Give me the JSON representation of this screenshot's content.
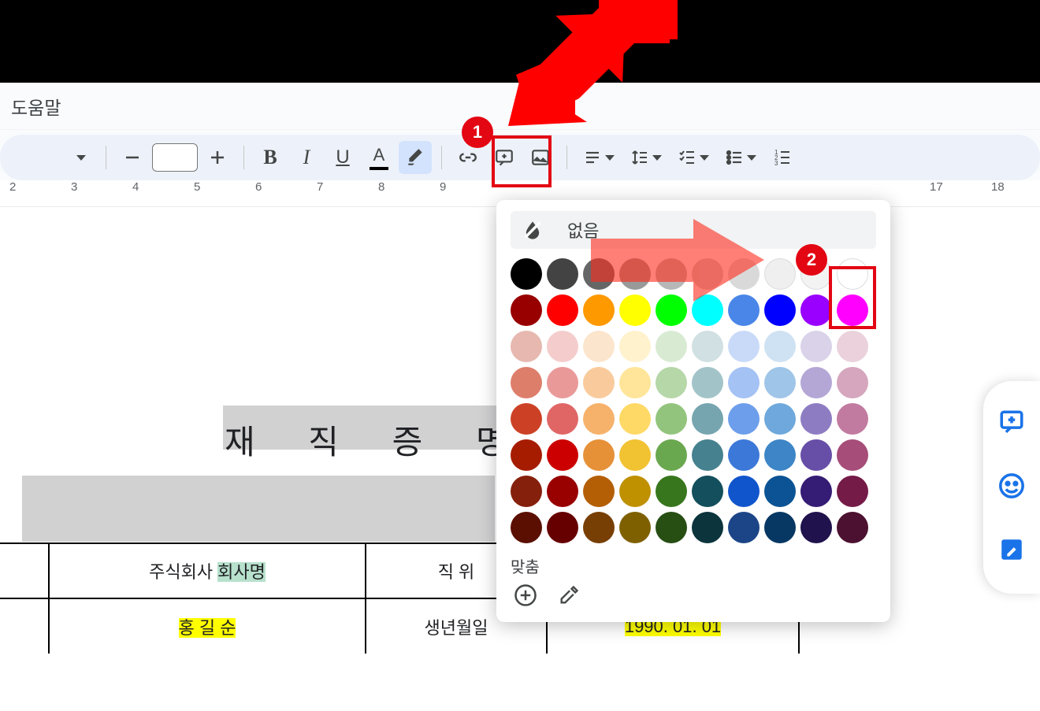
{
  "menubar": {
    "help": "도움말"
  },
  "toolbar": {
    "icons": [
      "font-dropdown",
      "decrease-font",
      "fontsize-box",
      "increase-font",
      "bold",
      "italic",
      "underline",
      "text-color",
      "highlight-color",
      "insert-link",
      "add-comment",
      "insert-image",
      "align",
      "line-spacing",
      "checklist",
      "bulleted-list",
      "numbered-list"
    ]
  },
  "ruler": {
    "numbers": [
      2,
      3,
      4,
      5,
      6,
      7,
      8,
      9,
      17,
      18
    ]
  },
  "document": {
    "title": "재 직 증 명 서",
    "table": {
      "rows": [
        {
          "cells": [
            "",
            "주식회사 회사명",
            "직 위",
            ""
          ]
        },
        {
          "cells": [
            "",
            "홍 길 순",
            "생년월일",
            "1990. 01. 01"
          ]
        }
      ],
      "highlights": {
        "company": "회사명",
        "name": "홍 길 순",
        "birth": "1990. 01. 01"
      }
    }
  },
  "color_picker": {
    "none_label": "없음",
    "custom_label": "맞춤",
    "rows": [
      [
        "#000000",
        "#434343",
        "#666666",
        "#999999",
        "#b7b7b7",
        "#cccccc",
        "#d9d9d9",
        "#efefef",
        "#f3f3f3",
        "#ffffff"
      ],
      [
        "#980000",
        "#ff0000",
        "#ff9900",
        "#ffff00",
        "#00ff00",
        "#00ffff",
        "#4a86e8",
        "#0000ff",
        "#9900ff",
        "#ff00ff"
      ],
      [
        "#e6b8af",
        "#f4cccc",
        "#fce5cd",
        "#fff2cc",
        "#d9ead3",
        "#d0e0e3",
        "#c9daf8",
        "#cfe2f3",
        "#d9d2e9",
        "#ead1dc"
      ],
      [
        "#dd7e6b",
        "#ea9999",
        "#f9cb9c",
        "#ffe599",
        "#b6d7a8",
        "#a2c4c9",
        "#a4c2f4",
        "#9fc5e8",
        "#b4a7d6",
        "#d5a6bd"
      ],
      [
        "#cc4125",
        "#e06666",
        "#f6b26b",
        "#ffd966",
        "#93c47d",
        "#76a5af",
        "#6d9eeb",
        "#6fa8dc",
        "#8e7cc3",
        "#c27ba0"
      ],
      [
        "#a61c00",
        "#cc0000",
        "#e69138",
        "#f1c232",
        "#6aa84f",
        "#45818e",
        "#3c78d8",
        "#3d85c6",
        "#674ea7",
        "#a64d79"
      ],
      [
        "#85200c",
        "#990000",
        "#b45f06",
        "#bf9000",
        "#38761d",
        "#134f5c",
        "#1155cc",
        "#0b5394",
        "#351c75",
        "#741b47"
      ],
      [
        "#5b0f00",
        "#660000",
        "#783f04",
        "#7f6000",
        "#274e13",
        "#0c343d",
        "#1c4587",
        "#073763",
        "#20124d",
        "#4c1130"
      ]
    ]
  },
  "annotations": {
    "badge1": "1",
    "badge2": "2"
  }
}
